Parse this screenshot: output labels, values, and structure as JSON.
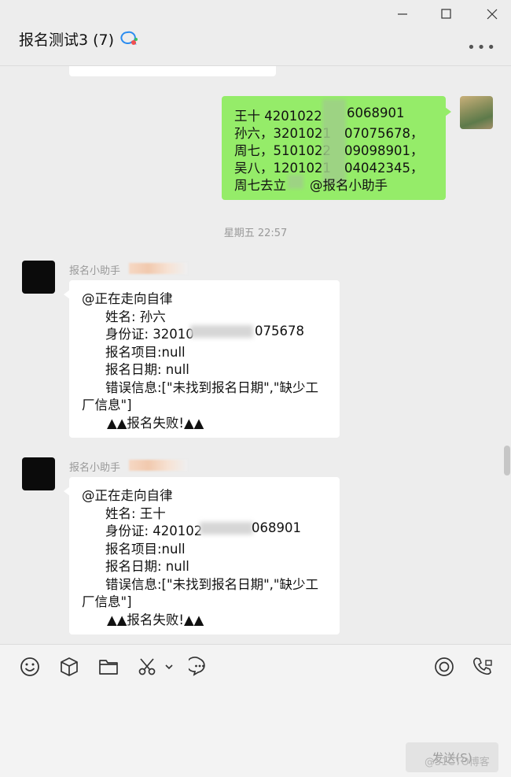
{
  "window": {
    "title": "报名测试3 (7)"
  },
  "messages": {
    "self": {
      "lines": [
        "王十 4201022",
        "孙六，3201021",
        "周七，5101022",
        "吴八，1201021",
        "周七去立",
        "6068901",
        "07075678，",
        "09098901，",
        "04042345，",
        "@报名小助手"
      ]
    },
    "timestamp": "星期五 22:57",
    "bot1": {
      "sender": "报名小助手",
      "mention": "@正在走向自律",
      "name": "姓名: 孙六",
      "id_prefix": "身份证: 32010",
      "id_suffix": "075678",
      "project": "报名项目:null",
      "date": "报名日期: null",
      "error_line1": "错误信息:[\"未找到报名日期\",\"缺少工",
      "error_line2": "厂信息\"]",
      "result": "▲▲报名失败!▲▲"
    },
    "bot2": {
      "sender": "报名小助手",
      "mention": "@正在走向自律",
      "name": "姓名: 王十",
      "id_prefix": "身份证: 420102",
      "id_suffix": "068901",
      "project": "报名项目:null",
      "date": "报名日期: null",
      "error_line1": "错误信息:[\"未找到报名日期\",\"缺少工",
      "error_line2": "厂信息\"]",
      "result": "▲▲报名失败!▲▲"
    }
  },
  "composer": {
    "tools": [
      "emoji-icon",
      "box-icon",
      "folder-icon",
      "scissors-icon",
      "chat-history-icon"
    ],
    "right_tools": [
      "live-icon",
      "call-icon"
    ],
    "send_label": "发送(S)",
    "watermark": "@51CTO博客"
  },
  "colors": {
    "self_bubble": "#95ec69",
    "bubble": "#ffffff",
    "background": "#ededed"
  }
}
